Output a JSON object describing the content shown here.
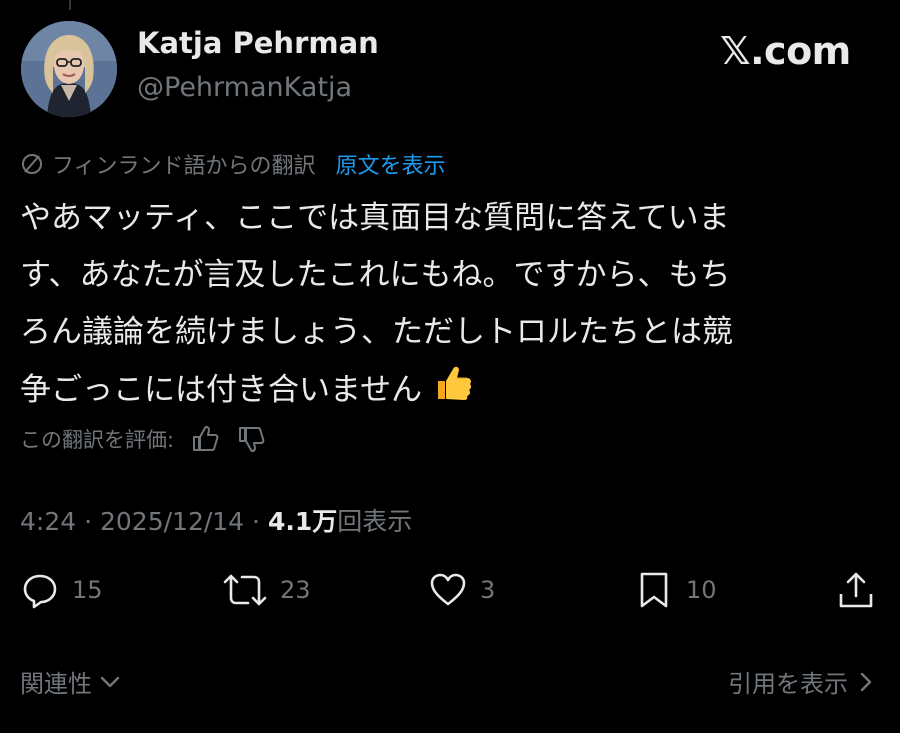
{
  "user": {
    "name": "Katja Pehrman",
    "handle": "@PehrmanKatja"
  },
  "brand": "𝕏.com",
  "translation": {
    "label": "フィンランド語からの翻訳",
    "show_original": "原文を表示"
  },
  "post": {
    "lines": [
      "やあマッティ、ここでは真面目な質問に答えていま",
      "す、あなたが言及したこれにもね。ですから、もち",
      "ろん議論を続けましょう、ただしトロルたちとは競",
      "争ごっこには付き合いません"
    ],
    "emoji": "👍"
  },
  "rate_translation": "この翻訳を評価:",
  "meta": {
    "time": "4:24",
    "date": "2025/12/14",
    "views_count": "4.1万",
    "views_label": "回表示"
  },
  "actions": {
    "replies": "15",
    "reposts": "23",
    "likes": "3",
    "bookmarks": "10"
  },
  "footer": {
    "related": "関連性",
    "view_quotes": "引用を表示"
  },
  "icons": [
    "translate-icon",
    "thumb-up-icon",
    "thumb-down-icon",
    "reply-icon",
    "repost-icon",
    "like-icon",
    "bookmark-icon",
    "share-icon",
    "chevron-down-icon",
    "chevron-right-icon"
  ],
  "colors": {
    "background": "#000000",
    "text": "#e7e9ea",
    "muted": "#71767b",
    "link": "#1d9bf0"
  }
}
